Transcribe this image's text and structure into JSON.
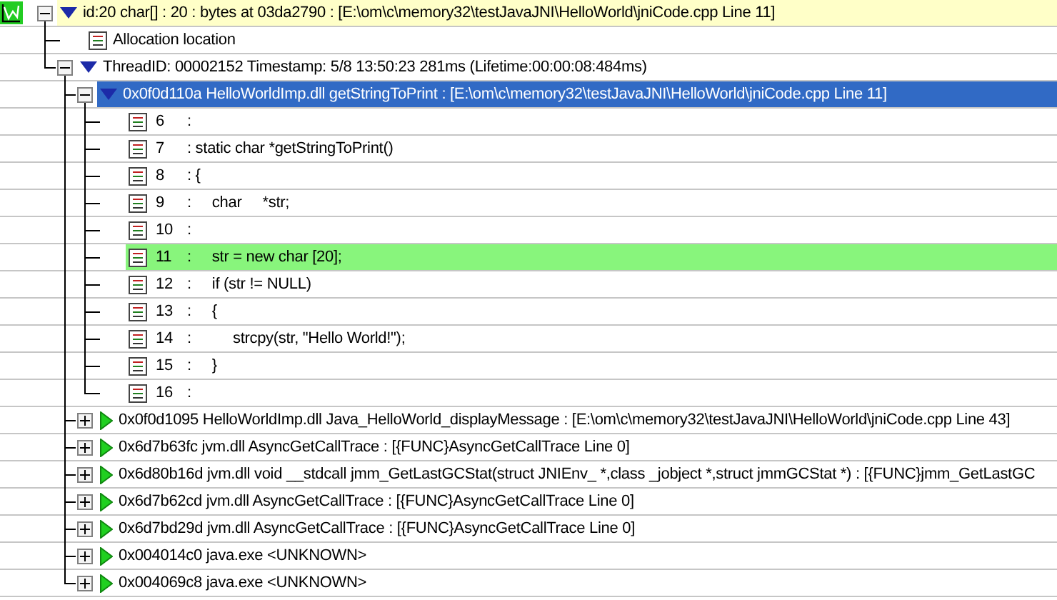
{
  "tree": [
    {
      "kind": "allocation",
      "text": "id:20 char[] : 20 : bytes at 03da2790 : [E:\\om\\c\\memory32\\testJavaJNI\\HelloWorld\\jniCode.cpp Line 11]",
      "expanded": true,
      "highlighted": true,
      "selected": false,
      "children": [
        {
          "kind": "location",
          "text": "Allocation location"
        },
        {
          "kind": "thread",
          "text": "ThreadID: 00002152 Timestamp: 5/8 13:50:23 281ms (Lifetime:00:00:08:484ms)",
          "expanded": true,
          "children": [
            {
              "kind": "frame",
              "text": "0x0f0d110a HelloWorldImp.dll getStringToPrint : [E:\\om\\c\\memory32\\testJavaJNI\\HelloWorld\\jniCode.cpp Line 11]",
              "expanded": true,
              "selected": true,
              "children": [
                {
                  "kind": "source",
                  "number": "6",
                  "separator": ":",
                  "highlighted": false
                },
                {
                  "kind": "source",
                  "number": "7",
                  "separator": ":",
                  "code": " static char *getStringToPrint()",
                  "highlighted": false
                },
                {
                  "kind": "source",
                  "number": "8",
                  "separator": ":",
                  "code": " {",
                  "highlighted": false
                },
                {
                  "kind": "source",
                  "number": "9",
                  "separator": ":",
                  "code": "     char     *str;",
                  "highlighted": false
                },
                {
                  "kind": "source",
                  "number": "10",
                  "separator": ":",
                  "highlighted": false
                },
                {
                  "kind": "source",
                  "number": "11",
                  "separator": ":",
                  "code": "     str = new char [20];",
                  "highlighted": true
                },
                {
                  "kind": "source",
                  "number": "12",
                  "separator": ":",
                  "code": "     if (str != NULL)",
                  "highlighted": false
                },
                {
                  "kind": "source",
                  "number": "13",
                  "separator": ":",
                  "code": "     {",
                  "highlighted": false
                },
                {
                  "kind": "source",
                  "number": "14",
                  "separator": ":",
                  "code": "          strcpy(str, \"Hello World!\");",
                  "highlighted": false
                },
                {
                  "kind": "source",
                  "number": "15",
                  "separator": ":",
                  "code": "     }",
                  "highlighted": false
                },
                {
                  "kind": "source",
                  "number": "16",
                  "separator": ":",
                  "highlighted": false
                }
              ]
            },
            {
              "kind": "frame",
              "text": "0x0f0d1095 HelloWorldImp.dll Java_HelloWorld_displayMessage : [E:\\om\\c\\memory32\\testJavaJNI\\HelloWorld\\jniCode.cpp Line 43]",
              "expanded": false,
              "selected": false
            },
            {
              "kind": "frame",
              "text": "0x6d7b63fc jvm.dll AsyncGetCallTrace : [{FUNC}AsyncGetCallTrace Line 0]",
              "expanded": false,
              "selected": false
            },
            {
              "kind": "frame",
              "text": "0x6d80b16d jvm.dll void __stdcall jmm_GetLastGCStat(struct JNIEnv_ *,class _jobject *,struct jmmGCStat *) : [{FUNC}jmm_GetLastGC",
              "expanded": false,
              "selected": false
            },
            {
              "kind": "frame",
              "text": "0x6d7b62cd jvm.dll AsyncGetCallTrace : [{FUNC}AsyncGetCallTrace Line 0]",
              "expanded": false,
              "selected": false
            },
            {
              "kind": "frame",
              "text": "0x6d7bd29d jvm.dll AsyncGetCallTrace : [{FUNC}AsyncGetCallTrace Line 0]",
              "expanded": false,
              "selected": false
            },
            {
              "kind": "frame",
              "text": "0x004014c0 java.exe <UNKNOWN>",
              "expanded": false,
              "selected": false
            },
            {
              "kind": "frame",
              "text": "0x004069c8 java.exe <UNKNOWN>",
              "expanded": false,
              "selected": false
            }
          ]
        }
      ]
    }
  ]
}
